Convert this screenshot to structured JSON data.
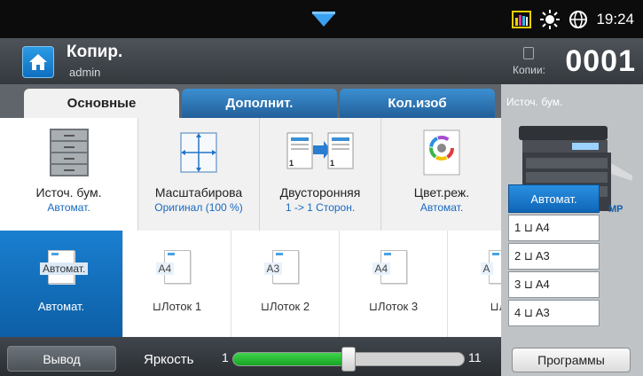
{
  "status_bar": {
    "time": "19:24",
    "icons": [
      "toner-level-icon",
      "brightness-icon",
      "globe-icon"
    ]
  },
  "header": {
    "title": "Копир.",
    "user": "admin",
    "copies_label": "Копии:",
    "copies_value": "0001"
  },
  "tabs": [
    {
      "label": "Основные",
      "active": true
    },
    {
      "label": "Дополнит.",
      "active": false
    },
    {
      "label": "Кол.изоб",
      "active": false
    }
  ],
  "options": [
    {
      "label": "Источ. бум.",
      "value": "Автомат.",
      "icon": "paper-trays-icon"
    },
    {
      "label": "Масштабирова",
      "value": "Оригинал (100 %)",
      "icon": "scale-icon"
    },
    {
      "label": "Двусторонняя",
      "value": "1 -> 1 Сторон.",
      "icon": "duplex-icon"
    },
    {
      "label": "Цвет.реж.",
      "value": "Автомат.",
      "icon": "color-wheel-icon"
    }
  ],
  "trays": [
    {
      "name": "Автомат.",
      "paper": "Автомат.",
      "selected": true
    },
    {
      "name": "Лоток 1",
      "paper": "A4",
      "selected": false
    },
    {
      "name": "Лоток 2",
      "paper": "A3",
      "selected": false
    },
    {
      "name": "Лоток 3",
      "paper": "A4",
      "selected": false
    },
    {
      "name": "Ло",
      "paper": "A",
      "selected": false
    }
  ],
  "bottom": {
    "output_label": "Вывод",
    "brightness_label": "Яркость",
    "brightness_min": "1",
    "brightness_max": "11",
    "brightness_value": 6
  },
  "right_panel": {
    "title": "Источ. бум.",
    "mp_label": "MP",
    "sources": [
      {
        "label": "Автомат.",
        "active": true
      },
      {
        "label": "1 ⊔ A4",
        "active": false
      },
      {
        "label": "2 ⊔ A3",
        "active": false
      },
      {
        "label": "3 ⊔ A4",
        "active": false
      },
      {
        "label": "4 ⊔ A3",
        "active": false
      }
    ],
    "programs_label": "Программы"
  },
  "colors": {
    "accent_blue": "#1769c2",
    "slider_green": "#2bbd37",
    "header_bg": "#3f454b"
  }
}
